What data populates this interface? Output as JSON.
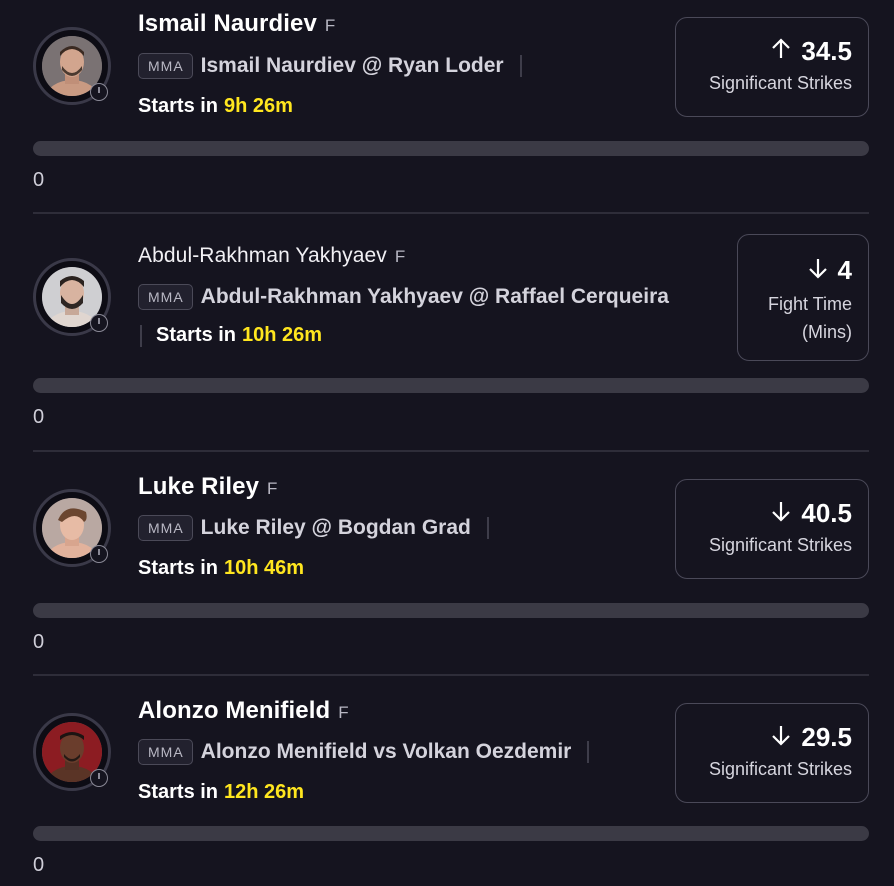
{
  "colors": {
    "background": "#15141f",
    "accent_time": "#ffe61f",
    "progress_track": "#3b3a45"
  },
  "props": [
    {
      "player": "Ismail Naurdiev",
      "position": "F",
      "league": "MMA",
      "matchup": "Ismail Naurdiev @ Ryan Loder",
      "starts_prefix": "Starts in",
      "starts_time": "9h 26m",
      "direction": "up",
      "direction_icon": "arrow-up-icon",
      "line": "34.5",
      "stat_label": "Significant Strikes",
      "progress": 0,
      "count": "0"
    },
    {
      "player": "Abdul-Rakhman Yakhyaev",
      "position": "F",
      "league": "MMA",
      "matchup": "Abdul-Rakhman Yakhyaev @ Raffael Cerqueira",
      "starts_prefix": "Starts in",
      "starts_time": "10h 26m",
      "direction": "down",
      "direction_icon": "arrow-down-icon",
      "line": "4",
      "stat_label_1": "Fight Time",
      "stat_label_2": "(Mins)",
      "progress": 0,
      "count": "0"
    },
    {
      "player": "Luke Riley",
      "position": "F",
      "league": "MMA",
      "matchup": "Luke Riley @ Bogdan Grad",
      "starts_prefix": "Starts in",
      "starts_time": "10h 46m",
      "direction": "down",
      "direction_icon": "arrow-down-icon",
      "line": "40.5",
      "stat_label": "Significant Strikes",
      "progress": 0,
      "count": "0"
    },
    {
      "player": "Alonzo Menifield",
      "position": "F",
      "league": "MMA",
      "matchup": "Alonzo Menifield vs Volkan Oezdemir",
      "starts_prefix": "Starts in",
      "starts_time": "12h 26m",
      "direction": "down",
      "direction_icon": "arrow-down-icon",
      "line": "29.5",
      "stat_label": "Significant Strikes",
      "progress": 0,
      "count": "0"
    }
  ]
}
